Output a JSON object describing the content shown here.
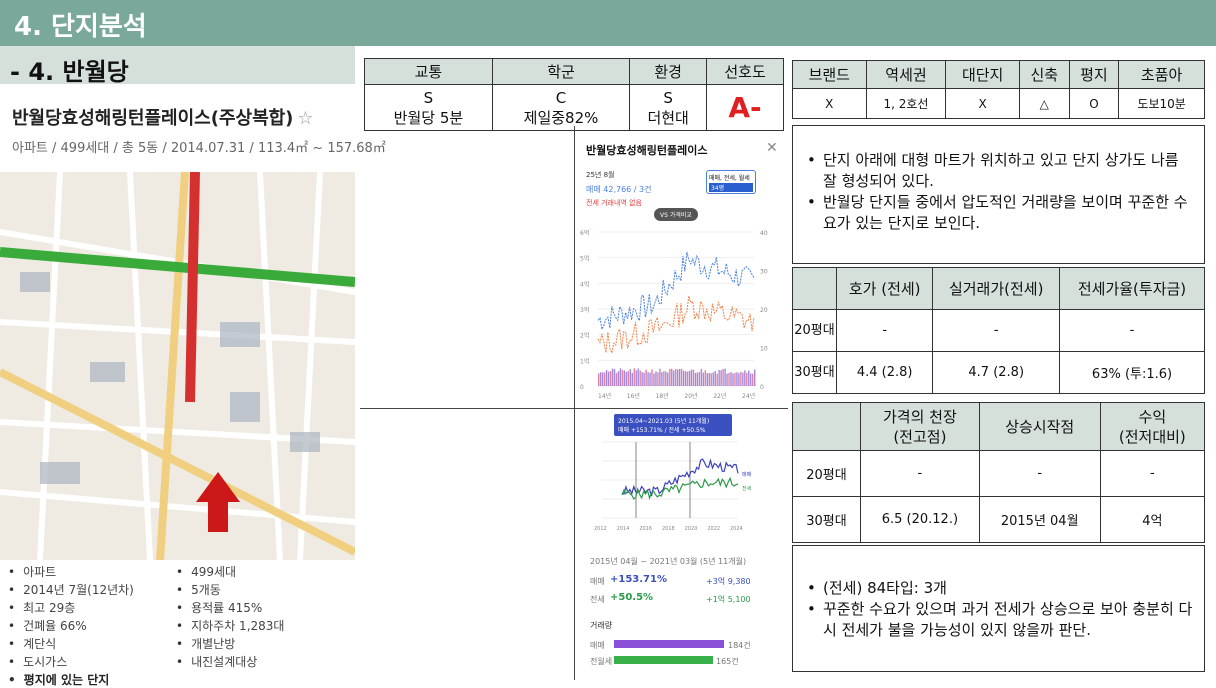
{
  "header": {
    "title": "4. 단지분석"
  },
  "section": {
    "title": "- 4. 반월당"
  },
  "complex": {
    "name": "반월당효성해링턴플레이스(주상복합)",
    "meta": "아파트 / 499세대 / 총 5동 / 2014.07.31 / 113.4㎡ ~ 157.68㎡"
  },
  "info": [
    {
      "text": "아파트"
    },
    {
      "text": "499세대"
    },
    {
      "text": "2014년 7월(12년차)"
    },
    {
      "text": "5개동"
    },
    {
      "text": "최고 29층"
    },
    {
      "text": "용적률 415%"
    },
    {
      "text": "건폐율 66%"
    },
    {
      "text": "지하주차 1,283대"
    },
    {
      "text": "계단식"
    },
    {
      "text": "개별난방"
    },
    {
      "text": "도시가스"
    },
    {
      "text": "내진설계대상"
    },
    {
      "text": "평지에 있는 단지"
    }
  ],
  "grade_table": {
    "headers": [
      "교통",
      "학군",
      "환경",
      "선호도"
    ],
    "grades": [
      "S",
      "C",
      "S"
    ],
    "notes": [
      "반월당 5분",
      "제일중82%",
      "더현대"
    ],
    "preference": "A-"
  },
  "feature_table": {
    "headers": [
      "브랜드",
      "역세권",
      "대단지",
      "신축",
      "평지",
      "초품아"
    ],
    "values": [
      "X",
      "1, 2호선",
      "X",
      "△",
      "O",
      "도보10분"
    ]
  },
  "note1": [
    "단지 아래에 대형 마트가 위치하고 있고 단지 상가도 나름 잘 형성되어 있다.",
    "반월당 단지들 중에서 압도적인 거래량을 보이며 꾸준한 수요가 있는 단지로 보인다."
  ],
  "price_table": {
    "headers": [
      "",
      "호가 (전세)",
      "실거래가(전세)",
      "전세가율(투자금)"
    ],
    "rows": [
      {
        "label": "20평대",
        "c1": "-",
        "c2": "-",
        "c3": "-"
      },
      {
        "label": "30평대",
        "c1": "4.4 (2.8)",
        "c2": "4.7 (2.8)",
        "c3": "63% (투:1.6)"
      }
    ]
  },
  "peak_table": {
    "headers": [
      "",
      "가격의 천장\n(전고점)",
      "상승시작점",
      "수익\n(전저대비)"
    ],
    "rows": [
      {
        "label": "20평대",
        "c1": "-",
        "c2": "-",
        "c3": "-"
      },
      {
        "label": "30평대",
        "c1": "6.5 (20.12.)",
        "c2": "2015년 04월",
        "c3": "4억"
      }
    ]
  },
  "note2": [
    "(전세) 84타입: 3개",
    "꾸준한 수요가 있으며 과거 전세가 상승으로 보아 충분히 다시 전세가 불을 가능성이 있지 않을까 판단."
  ],
  "chart1": {
    "title": "반월당효성해링턴플레이스",
    "date": "25년 8월",
    "sale": "매매 42,766 / 3건",
    "lease": "전세 거래내역 없음",
    "filter": "매매, 전세, 월세",
    "size": "34평",
    "compare": "VS 가격비교",
    "xticks": [
      "14년",
      "16년",
      "18년",
      "20년",
      "22년",
      "24년"
    ],
    "yticks": [
      "6억",
      "5억",
      "4억",
      "3억",
      "2억",
      "1억",
      "0"
    ],
    "y2ticks": [
      "40",
      "30",
      "20",
      "10",
      "0"
    ],
    "colors": {
      "sale": "#4a7fe0",
      "lease": "#f0824a"
    }
  },
  "chart2": {
    "label": "2015.04~2021.03 (5년 11개월)",
    "change": "매매 +153.71% / 전세 +50.5%",
    "legend": [
      "매매",
      "전세"
    ],
    "xticks": [
      "2012",
      "2014",
      "2016",
      "2018",
      "2020",
      "2022",
      "2024"
    ]
  },
  "chart3": {
    "period": "2015년 04월 ~ 2021년 03월 (5년 11개월)",
    "sale_label": "매매",
    "sale_pct": "+153.71%",
    "sale_amt": "+3억 9,380",
    "lease_label": "전세",
    "lease_pct": "+50.5%",
    "lease_amt": "+1억 5,100",
    "volume_title": "거래량",
    "vol_sale_label": "매매",
    "vol_sale": "184건",
    "vol_lease_label": "전월세",
    "vol_lease": "165건",
    "vol_sale_fraction": 1.0,
    "vol_lease_fraction": 0.9
  }
}
